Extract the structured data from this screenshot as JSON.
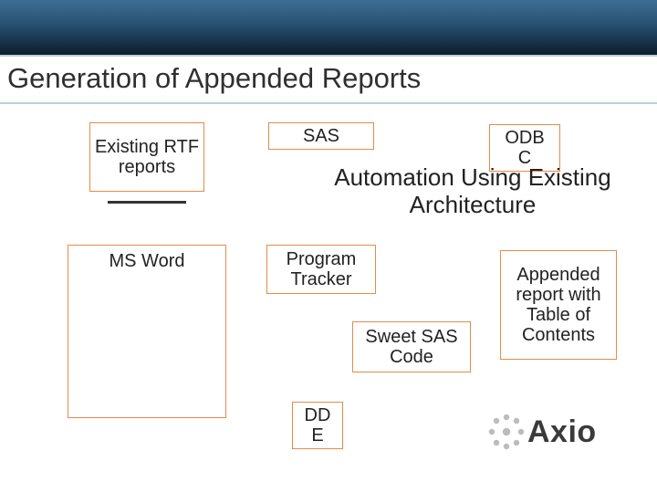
{
  "title": "Generation of Appended Reports",
  "boxes": {
    "existing_rtf": "Existing RTF reports",
    "sas": "SAS",
    "odbc": "ODB\nC",
    "ms_word": "MS Word",
    "program_tracker": "Program Tracker",
    "sweet_sas": "Sweet SAS Code",
    "appended_report": "Appended report with Table of Contents",
    "dde": "DD\nE"
  },
  "subtitle": "Automation Using Existing Architecture",
  "logo_text": "Axio"
}
